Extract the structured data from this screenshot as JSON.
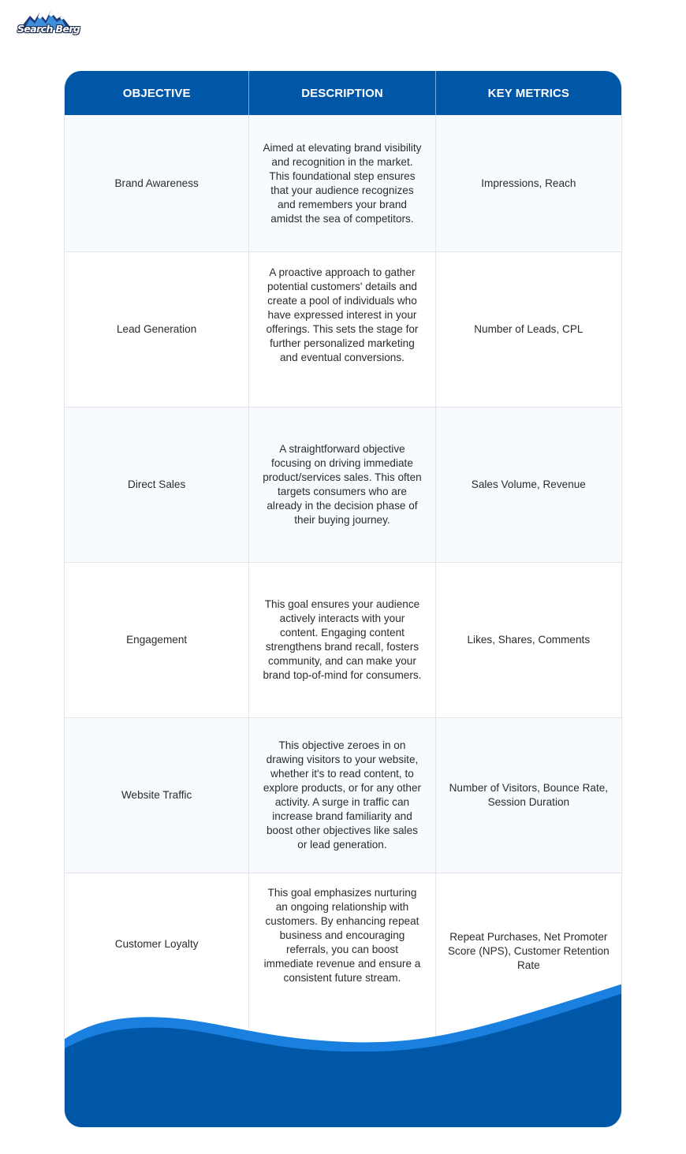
{
  "brand": {
    "logo_text": "Search Berg",
    "primary_color": "#0057a8",
    "accent_color": "#1a80e0"
  },
  "table": {
    "headers": [
      "OBJECTIVE",
      "DESCRIPTION",
      "KEY METRICS"
    ],
    "rows": [
      {
        "objective": "Brand Awareness",
        "description": "Aimed at elevating brand visibility and recognition in the market. This foundational step ensures that your audience recognizes and remembers your brand amidst the sea of competitors.",
        "metrics": "Impressions, Reach"
      },
      {
        "objective": "Lead Generation",
        "description": "A proactive approach to gather potential customers' details and create a pool of individuals who have expressed interest in your offerings. This sets the stage for further personalized marketing and eventual conversions.",
        "metrics": "Number of Leads, CPL"
      },
      {
        "objective": "Direct Sales",
        "description": "A straightforward objective focusing on driving immediate product/services sales. This often targets consumers who are already in the decision phase of their buying journey.",
        "metrics": "Sales Volume, Revenue"
      },
      {
        "objective": "Engagement",
        "description": "This goal ensures your audience actively interacts with your content. Engaging content strengthens brand recall, fosters community, and can make your brand top-of-mind for consumers.",
        "metrics": "Likes, Shares, Comments"
      },
      {
        "objective": "Website Traffic",
        "description": "This objective zeroes in on drawing visitors to your website, whether it's to read content, to explore products, or for any other activity. A surge in traffic can increase brand familiarity and boost other objectives like sales or lead generation.",
        "metrics": "Number of Visitors, Bounce Rate, Session Duration"
      },
      {
        "objective": "Customer Loyalty",
        "description": "This goal emphasizes nurturing an ongoing relationship with customers. By enhancing repeat business and encouraging referrals, you can boost immediate revenue and ensure a consistent future stream.",
        "metrics": "Repeat Purchases, Net Promoter Score (NPS), Customer Retention Rate"
      }
    ]
  }
}
